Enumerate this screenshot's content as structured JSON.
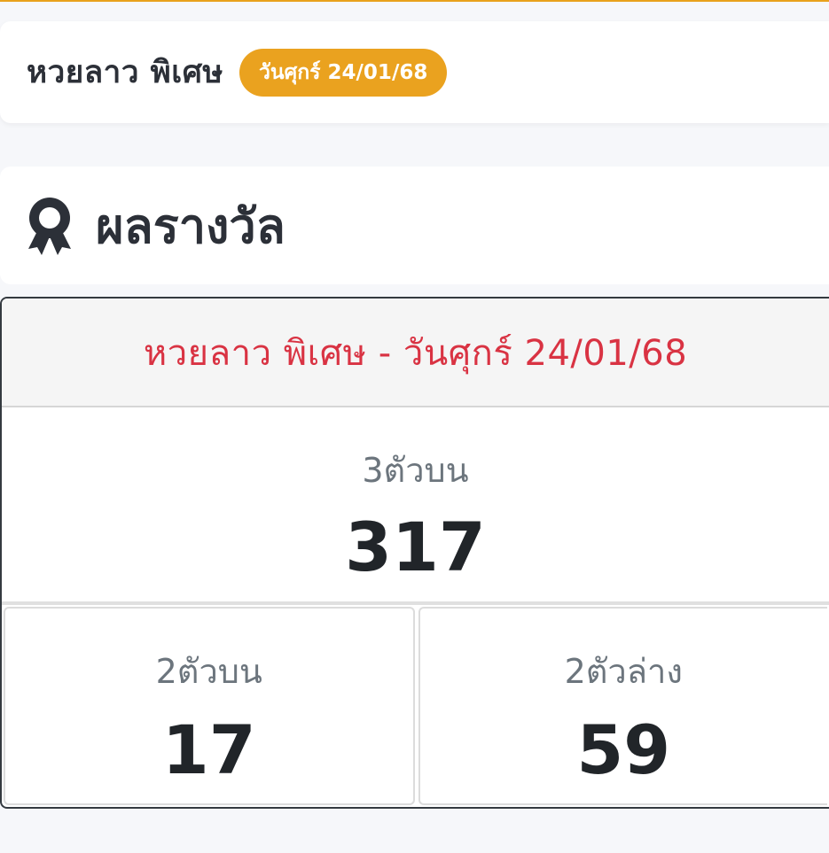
{
  "header": {
    "title": "หวยลาว พิเศษ",
    "date_badge": "วันศุกร์ 24/01/68"
  },
  "section": {
    "icon": "award-icon",
    "title": "ผลรางวัล"
  },
  "results": {
    "heading": "หวยลาว พิเศษ - วันศุกร์ 24/01/68",
    "three_top": {
      "label": "3ตัวบน",
      "value": "317"
    },
    "two_top": {
      "label": "2ตัวบน",
      "value": "17"
    },
    "two_bottom": {
      "label": "2ตัวล่าง",
      "value": "59"
    }
  },
  "colors": {
    "accent": "#eaa21f",
    "heading_red": "#d93343",
    "text_dark": "#2c3038",
    "label_gray": "#6c757d"
  }
}
